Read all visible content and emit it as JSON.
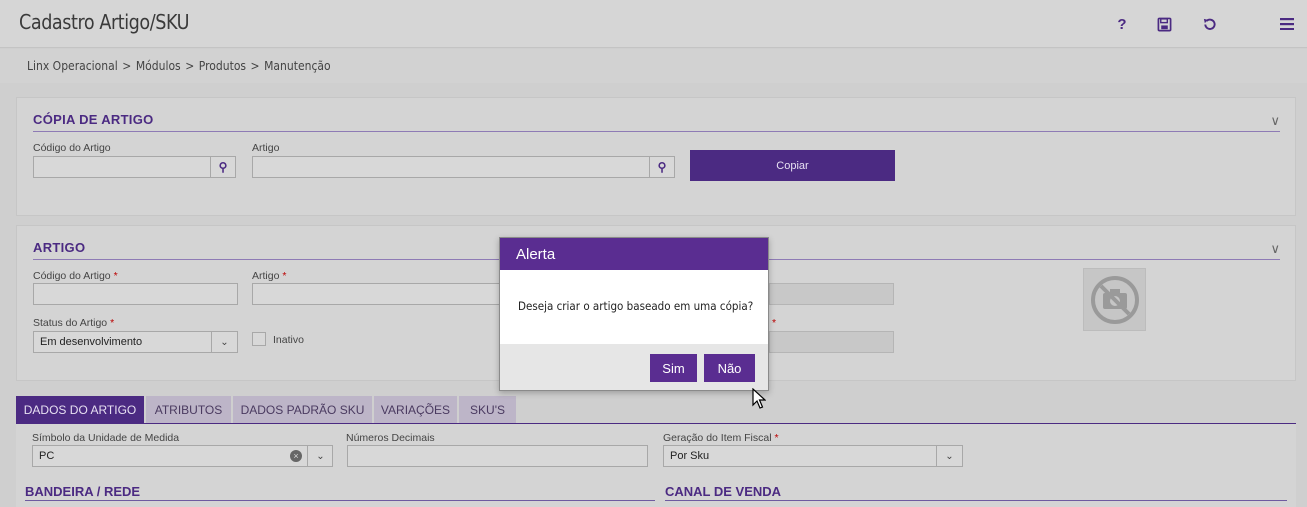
{
  "header": {
    "title": "Cadastro Artigo/SKU",
    "icons": [
      "help-icon",
      "save-icon",
      "undo-icon",
      "menu-icon"
    ],
    "help_glyph": "?"
  },
  "breadcrumb": [
    "Linx Operacional",
    "Módulos",
    "Produtos",
    "Manutenção"
  ],
  "breadcrumb_sep": ">",
  "copy_section": {
    "title": "CÓPIA DE ARTIGO",
    "code_label": "Código do Artigo",
    "code_value": "",
    "article_label": "Artigo",
    "article_value": "",
    "copy_button": "Copiar"
  },
  "article_section": {
    "title": "ARTIGO",
    "code_label": "Código do Artigo",
    "code_value": "",
    "article_label": "Artigo",
    "article_value": "",
    "status_label": "Status do Artigo",
    "status_value": "Em desenvolvimento",
    "inactive_label": "Inativo",
    "required_mark": "*"
  },
  "tabs": [
    {
      "label": "DADOS DO ARTIGO",
      "active": true
    },
    {
      "label": "ATRIBUTOS",
      "active": false
    },
    {
      "label": "DADOS PADRÃO SKU",
      "active": false
    },
    {
      "label": "VARIAÇÕES",
      "active": false
    },
    {
      "label": "SKU'S",
      "active": false
    }
  ],
  "details": {
    "unit_label": "Símbolo da Unidade de Medida",
    "unit_value": "PC",
    "decimals_label": "Números Decimais",
    "decimals_value": "",
    "fiscal_label": "Geração do Item Fiscal",
    "fiscal_value": "Por Sku",
    "banner_title": "BANDEIRA / REDE",
    "channel_title": "CANAL DE VENDA"
  },
  "modal": {
    "title": "Alerta",
    "message": "Deseja criar o artigo baseado em uma cópia?",
    "yes": "Sim",
    "no": "Não"
  },
  "colors": {
    "accent": "#4b2a82",
    "modal_header": "#5a2d91"
  }
}
